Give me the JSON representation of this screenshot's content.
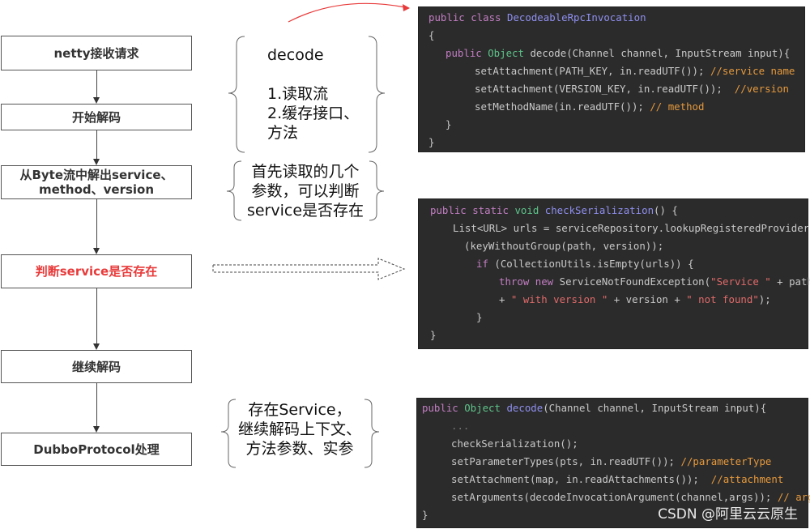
{
  "flow": {
    "steps": [
      {
        "label": "netty接收请求"
      },
      {
        "label": "开始解码"
      },
      {
        "label_line1": "从Byte流中解出service、",
        "label_line2": "method、version"
      },
      {
        "label": "判断service是否存在",
        "color": "#e83a3a"
      },
      {
        "label": "继续解码"
      },
      {
        "label": "DubboProtocol处理"
      }
    ]
  },
  "notes": {
    "decode": {
      "title": "decode",
      "line1": "1.读取流",
      "line2": "2.缓存接口、",
      "line3": "方法"
    },
    "first_read": {
      "line1": "首先读取的几个",
      "line2": "参数，可以判断",
      "line3": "service是否存在"
    },
    "continue": {
      "line1": "存在Service，",
      "line2": "继续解码上下文、",
      "line3": "方法参数、实参"
    }
  },
  "code_blocks": [
    {
      "name": "decodeable-rpc-invocation",
      "lines": [
        {
          "kw": "public class ",
          "fn": "DecodeableRpcInvocation"
        },
        {
          "text": "{"
        },
        {
          "kw": "public ",
          "ty": "Object",
          "text": " decode(Channel channel, InputStream input){"
        },
        {
          "text": "setAttachment(PATH_KEY, in.readUTF()); ",
          "cm": "//service name"
        },
        {
          "text": "setAttachment(VERSION_KEY, in.readUTF());  ",
          "cm": "//version"
        },
        {
          "text": "setMethodName(in.readUTF()); ",
          "cm": "// method"
        },
        {
          "text": "}"
        },
        {
          "text": "}"
        }
      ]
    },
    {
      "name": "check-serialization",
      "lines": [
        {
          "kw": "public static ",
          "ty": "void ",
          "fn": "checkSerialization",
          "text": "() {"
        },
        {
          "text": "List<URL> urls = serviceRepository.lookupRegisteredProvider"
        },
        {
          "text": "(keyWithoutGroup(path, version));"
        },
        {
          "kw": "if ",
          "text": "(CollectionUtils.isEmpty(urls)) {"
        },
        {
          "kw": "throw new ",
          "text": "ServiceNotFoundException(",
          "st": "\"Service \"",
          "text2": " + path"
        },
        {
          "text": "+ ",
          "st": "\" with version \"",
          "text2": " + version + ",
          "st2": "\" not found\"",
          "text3": ");"
        },
        {
          "text": "}"
        },
        {
          "text": "}"
        }
      ]
    },
    {
      "name": "decode-continue",
      "lines": [
        {
          "kw": "public ",
          "ty": "Object ",
          "fn": "decode",
          "text": "(Channel channel, InputStream input){"
        },
        {
          "text": "..."
        },
        {
          "text": "checkSerialization();"
        },
        {
          "text": "setParameterTypes(pts, in.readUTF()); ",
          "cm": "//parameterType"
        },
        {
          "text": "setAttachment(map, in.readAttachments());  ",
          "cm": "//attachment"
        },
        {
          "text": "setArguments(decodeInvocationArgument(channel,args)); ",
          "cm": "// args"
        },
        {
          "text": "}"
        }
      ]
    }
  ],
  "watermark": "CSDN @阿里云云原生",
  "colors": {
    "highlight": "#e83a3a",
    "code_bg": "#2b2b2b",
    "keyword": "#c27ec2",
    "type": "#5ec48a",
    "function": "#8f8ff0",
    "comment": "#e5993d",
    "string": "#e06a6a"
  }
}
